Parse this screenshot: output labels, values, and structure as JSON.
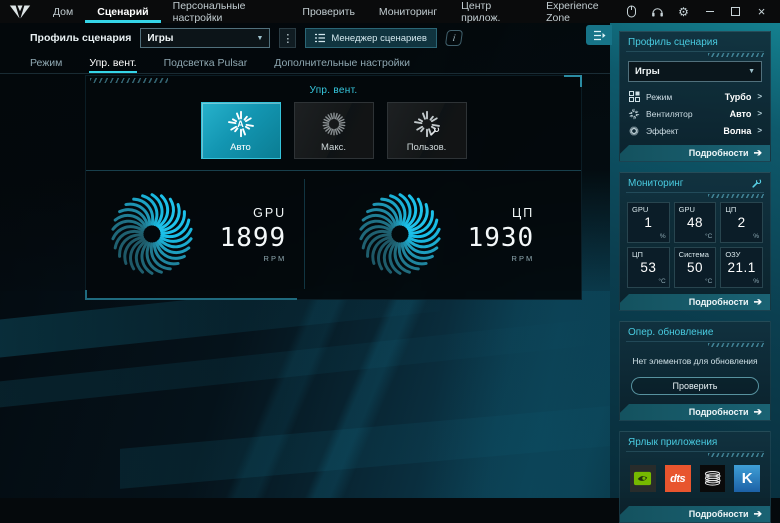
{
  "topbar": {
    "nav": [
      {
        "label": "Дом"
      },
      {
        "label": "Сценарий",
        "active": true
      },
      {
        "label": "Персональные настройки"
      },
      {
        "label": "Проверить"
      },
      {
        "label": "Мониторинг"
      },
      {
        "label": "Центр прилож."
      },
      {
        "label": "Experience Zone"
      }
    ]
  },
  "profile_bar": {
    "label": "Профиль сценария",
    "selected_profile": "Игры",
    "manager_button": "Менеджер сценариев"
  },
  "tabs": [
    {
      "label": "Режим"
    },
    {
      "label": "Упр. вент.",
      "active": true
    },
    {
      "label": "Подсветка Pulsar"
    },
    {
      "label": "Дополнительные настройки"
    }
  ],
  "fan_panel": {
    "title": "Упр. вент.",
    "modes": [
      {
        "label": "Авто",
        "letter": "A",
        "active": true
      },
      {
        "label": "Макс."
      },
      {
        "label": "Пользов."
      }
    ],
    "gauges": [
      {
        "label": "GPU",
        "value": "1899",
        "unit": "RPM"
      },
      {
        "label": "ЦП",
        "value": "1930",
        "unit": "RPM"
      }
    ]
  },
  "sidebar": {
    "details_label": "Подробности",
    "profile_panel": {
      "title": "Профиль сценария",
      "dropdown_value": "Игры",
      "rows": [
        {
          "label": "Режим",
          "value": "Турбо"
        },
        {
          "label": "Вентилятор",
          "value": "Авто"
        },
        {
          "label": "Эффект",
          "value": "Волна"
        }
      ]
    },
    "monitoring_panel": {
      "title": "Мониторинг",
      "tiles": [
        {
          "label": "GPU",
          "value": "1",
          "unit": "%"
        },
        {
          "label": "GPU",
          "value": "48",
          "unit": "°C"
        },
        {
          "label": "ЦП",
          "value": "2",
          "unit": "%"
        },
        {
          "label": "ЦП",
          "value": "53",
          "unit": "°C"
        },
        {
          "label": "Система",
          "value": "50",
          "unit": "°C"
        },
        {
          "label": "ОЗУ",
          "value": "21.1",
          "unit": "%"
        }
      ]
    },
    "update_panel": {
      "title": "Опер. обновление",
      "message": "Нет элементов для обновления",
      "button_label": "Проверить"
    },
    "shortcuts_panel": {
      "title": "Ярлык приложения",
      "apps": [
        {
          "name": "nvidia"
        },
        {
          "name": "dts",
          "text": "dts"
        },
        {
          "name": "coil"
        },
        {
          "name": "killer",
          "text": "K"
        }
      ]
    }
  },
  "icons": {
    "kebab": "⋮",
    "info": "i",
    "gear": "⚙",
    "close": "×",
    "dropdown_caret": "▼",
    "row_chevron": ">",
    "details_arrow": "➔"
  }
}
